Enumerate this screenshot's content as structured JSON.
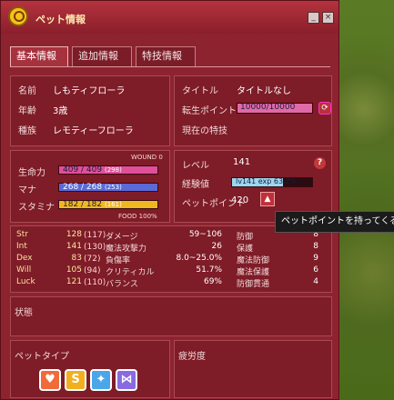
{
  "window": {
    "title": "ペット情報"
  },
  "tabs": [
    {
      "label": "基本情報"
    },
    {
      "label": "追加情報"
    },
    {
      "label": "特技情報"
    }
  ],
  "basic": {
    "name_label": "名前",
    "name": "しもティフローラ",
    "age_label": "年齢",
    "age": "3歳",
    "species_label": "種族",
    "species": "レモティーフローラ",
    "title_label": "タイトル",
    "title_value": "タイトルなし",
    "rebirth_label": "転生ポイント",
    "rebirth_value": "10000/10000",
    "current_skill_label": "現在の特技"
  },
  "vitals": {
    "wound": "WOUND 0",
    "hp_label": "生命力",
    "hp": "409 / 409",
    "hp_base": "(298)",
    "mp_label": "マナ",
    "mp": "268 / 268",
    "mp_base": "(253)",
    "sp_label": "スタミナ",
    "sp": "182 / 182",
    "sp_base": "(161)",
    "food": "FOOD 100%",
    "hp_fill": 1.0,
    "mp_fill": 1.0,
    "sp_fill": 1.0
  },
  "level": {
    "level_label": "レベル",
    "level": "141",
    "exp_label": "経験値",
    "exp_text": "lv141 exp 63.2%",
    "exp_fill": 0.632,
    "pet_points_label": "ペットポイント",
    "pet_points": "420"
  },
  "tooltip": "ペットポイントを持ってくる",
  "stats": [
    {
      "label": "Str",
      "value": "128",
      "base": "(117)"
    },
    {
      "label": "Int",
      "value": "141",
      "base": "(130)"
    },
    {
      "label": "Dex",
      "value": "83",
      "base": "(72)"
    },
    {
      "label": "Will",
      "value": "105",
      "base": "(94)"
    },
    {
      "label": "Luck",
      "value": "121",
      "base": "(110)"
    }
  ],
  "combat": [
    {
      "label": "ダメージ",
      "value": "59~106"
    },
    {
      "label": "魔法攻撃力",
      "value": "26"
    },
    {
      "label": "負傷率",
      "value": "8.0~25.0%"
    },
    {
      "label": "クリティカル",
      "value": "51.7%"
    },
    {
      "label": "バランス",
      "value": "69%"
    }
  ],
  "defense": [
    {
      "label": "防御",
      "value": "8"
    },
    {
      "label": "保護",
      "value": "8"
    },
    {
      "label": "魔法防御",
      "value": "9"
    },
    {
      "label": "魔法保護",
      "value": "6"
    },
    {
      "label": "防御貫通",
      "value": "4"
    }
  ],
  "status_label": "状態",
  "pet_type_label": "ペットタイプ",
  "fatigue_label": "疲労度",
  "pet_types": [
    {
      "glyph": "♥",
      "color": "#f06a3a"
    },
    {
      "glyph": "S",
      "color": "#f0b020"
    },
    {
      "glyph": "✦",
      "color": "#4aa6e8"
    },
    {
      "glyph": "⋈",
      "color": "#8a6ae0"
    }
  ],
  "colors": {
    "hp": "#e0509a",
    "mp": "#5a6ad8",
    "sp": "#f0b820",
    "exp": "#9ad8f0"
  }
}
